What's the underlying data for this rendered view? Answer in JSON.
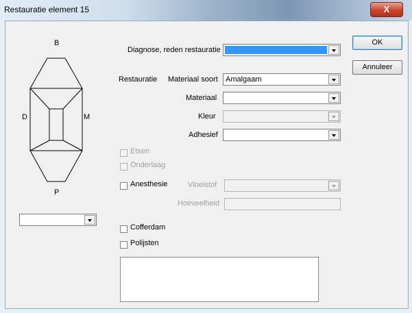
{
  "window": {
    "title": "Restauratie element 15",
    "close_label": "X"
  },
  "tooth": {
    "top": "B",
    "bottom": "P",
    "left": "D",
    "right": "M"
  },
  "surface_combo": {
    "value": ""
  },
  "diagnose": {
    "label": "Diagnose, reden restauratie",
    "value": ""
  },
  "restauratie": {
    "section_label": "Restauratie",
    "materiaal_soort": {
      "label": "Materiaal soort",
      "value": "Amalgaam"
    },
    "materiaal": {
      "label": "Materiaal",
      "value": ""
    },
    "kleur": {
      "label": "Kleur",
      "value": ""
    },
    "adhesief": {
      "label": "Adhesief",
      "value": ""
    }
  },
  "checkboxes": {
    "etsen": "Etsen",
    "onderlaag": "Onderlaag",
    "anesthesie": "Anesthesie",
    "cofferdam": "Cofferdam",
    "polijsten": "Polijsten"
  },
  "anesthesie": {
    "vloeistof_label": "Vloeistof",
    "vloeistof_value": "",
    "hoeveelheid_label": "Hoeveelheid",
    "hoeveelheid_value": ""
  },
  "notes": {
    "value": ""
  },
  "buttons": {
    "ok": "OK",
    "annuleer": "Annuleer"
  }
}
